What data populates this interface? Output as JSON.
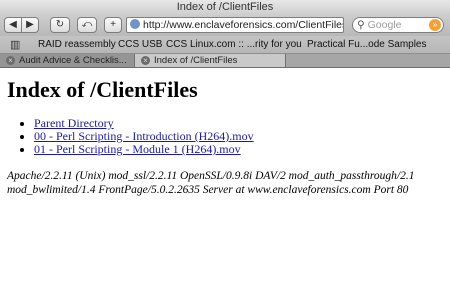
{
  "window": {
    "title": "Index of /ClientFiles"
  },
  "toolbar": {
    "back_icon": "back-icon",
    "forward_icon": "forward-icon",
    "url": "http://www.enclaveforensics.com/ClientFiles/",
    "search_placeholder": "Google"
  },
  "bookmarks": [
    "RAID reassembly",
    "CCS USB",
    "CCS",
    "Linux.com :: ...rity for you",
    "Practical Fu...ode Samples"
  ],
  "tabs": [
    {
      "label": "Audit Advice & Checklis..."
    },
    {
      "label": "Index of /ClientFiles"
    }
  ],
  "page": {
    "heading": "Index of /ClientFiles",
    "links": [
      "Parent Directory",
      "00 - Perl Scripting - Introduction (H264).mov",
      "01 - Perl Scripting - Module 1 (H264).mov"
    ],
    "address": "Apache/2.2.11 (Unix) mod_ssl/2.2.11 OpenSSL/0.9.8i DAV/2 mod_auth_passthrough/2.1 mod_bwlimited/1.4 FrontPage/5.0.2.2635 Server at www.enclaveforensics.com Port 80"
  }
}
